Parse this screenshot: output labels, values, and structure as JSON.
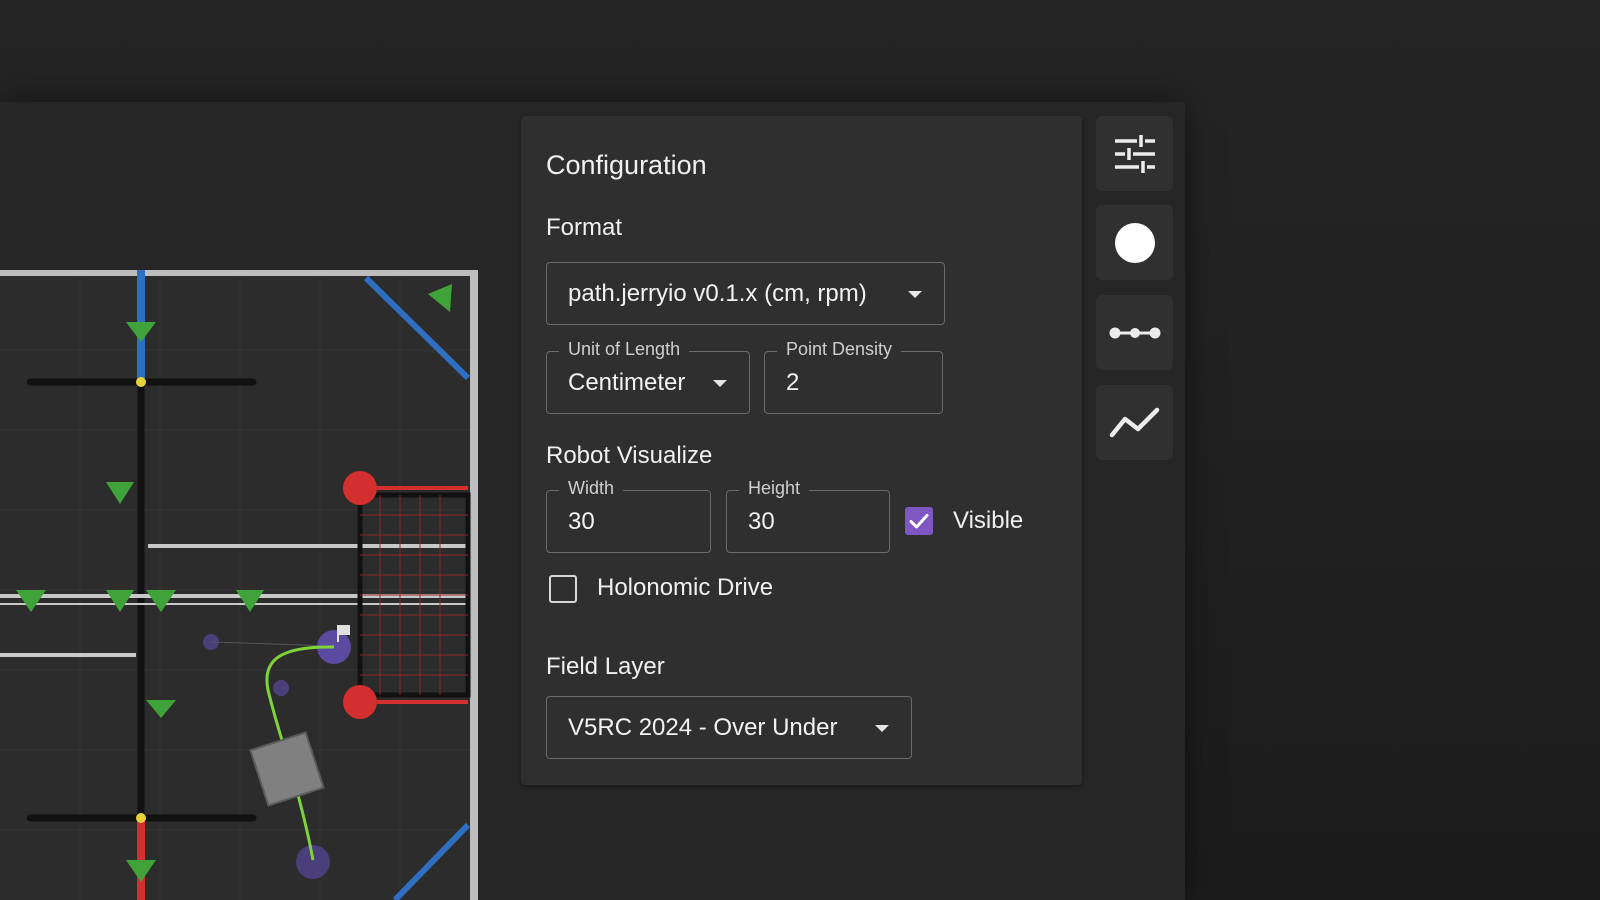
{
  "config": {
    "title": "Configuration",
    "format": {
      "label": "Format",
      "value": "path.jerryio v0.1.x (cm, rpm)"
    },
    "unit_of_length": {
      "label": "Unit of Length",
      "value": "Centimeter"
    },
    "point_density": {
      "label": "Point Density",
      "value": "2"
    },
    "robot_visualize": {
      "label": "Robot Visualize",
      "width_label": "Width",
      "width_value": "30",
      "height_label": "Height",
      "height_value": "30",
      "visible_label": "Visible",
      "visible_checked": true
    },
    "holonomic": {
      "label": "Holonomic Drive",
      "checked": false
    },
    "field_layer": {
      "label": "Field Layer",
      "value": "V5RC 2024 - Over Under"
    }
  },
  "toolbar": {
    "icons": [
      "sliders-icon",
      "circle-icon",
      "control-points-icon",
      "speed-graph-icon"
    ]
  },
  "colors": {
    "accent": "#7e57c2",
    "panel_bg": "#2f2f2f",
    "app_bg": "#262626",
    "path_green": "#7fd23a",
    "red_alliance": "#d32f2f",
    "blue_alliance": "#2f6fc2",
    "triball_green": "#3fa33a"
  }
}
